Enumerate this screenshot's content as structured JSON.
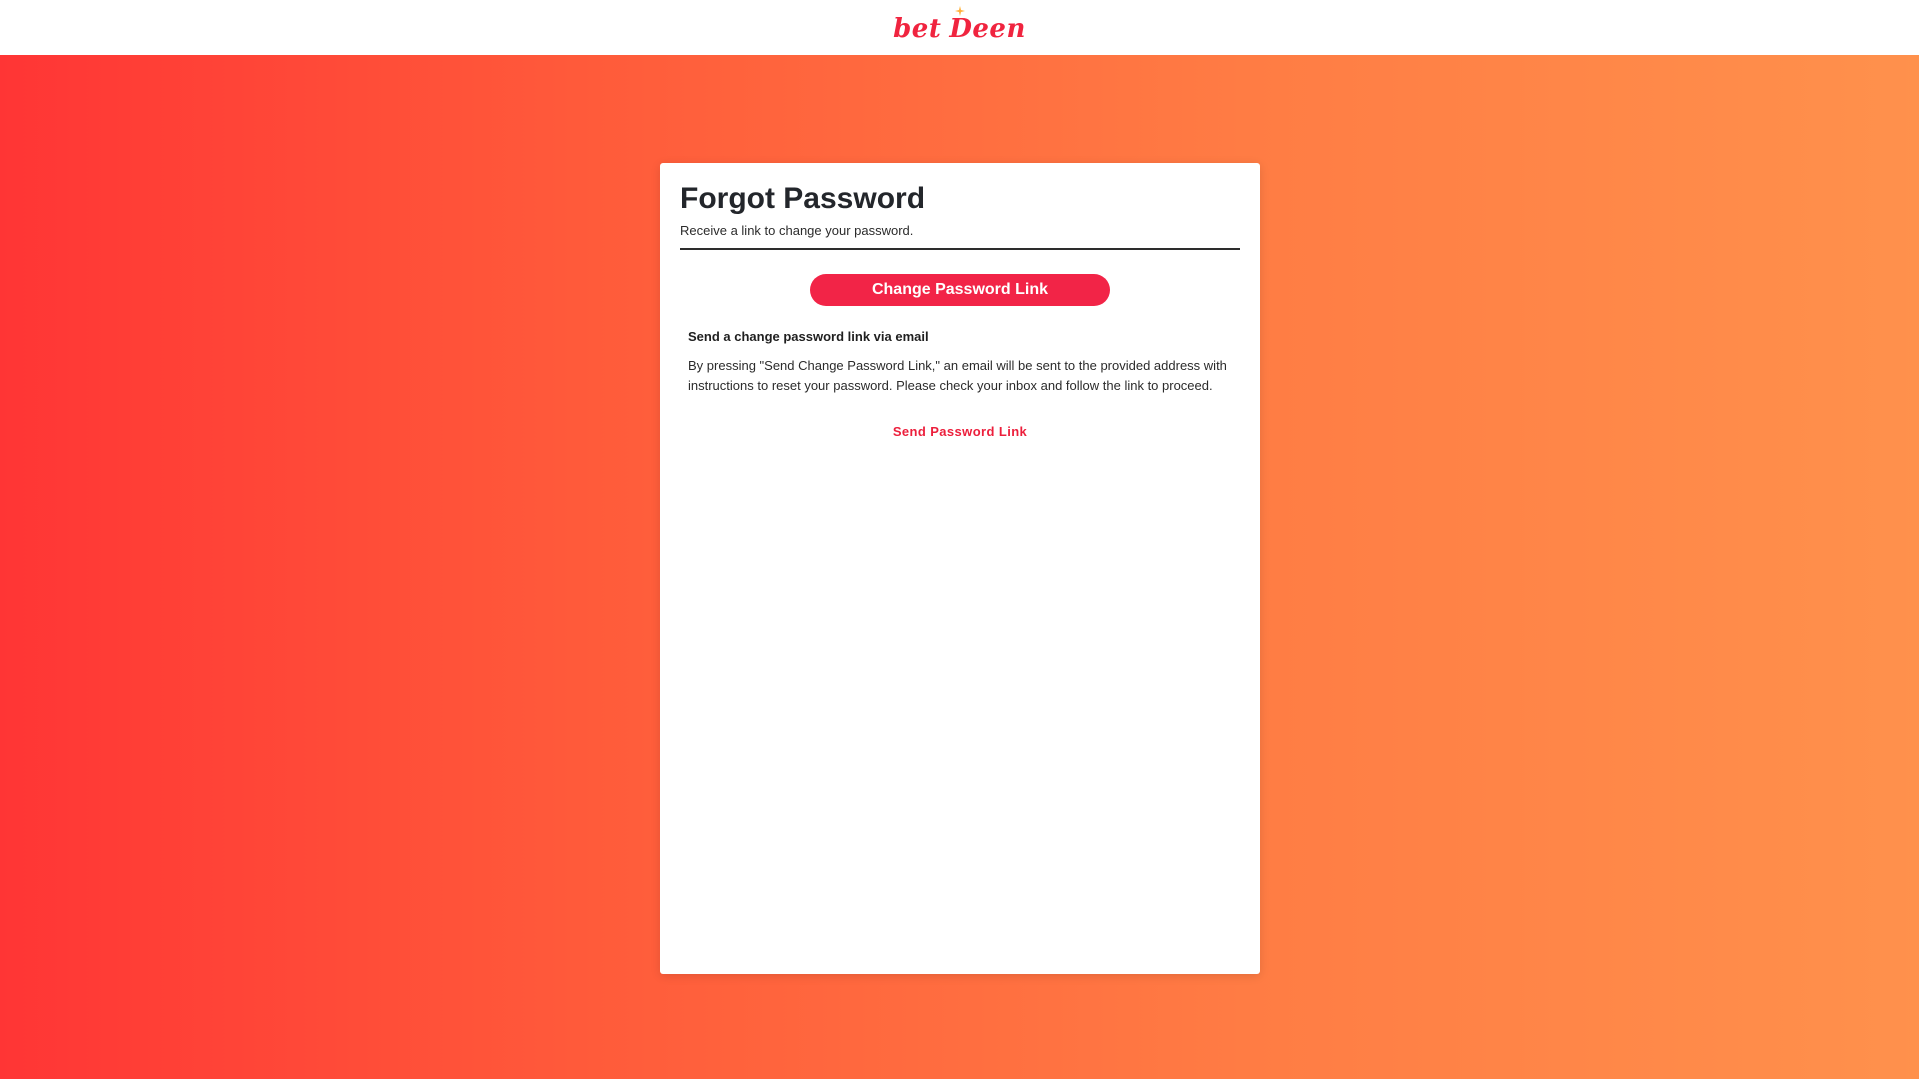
{
  "header": {
    "logo_part1": "bet",
    "logo_part2": "Deen"
  },
  "card": {
    "title": "Forgot Password",
    "subtitle": "Receive a link to change your password.",
    "primary_button_label": "Change Password Link",
    "section_title": "Send a change password link via email",
    "section_text": "By pressing \"Send Change Password Link,\" an email will be sent to the provided address with instructions to reset your password. Please check your inbox and follow the link to proceed.",
    "send_link_label": "Send Password Link"
  },
  "colors": {
    "brand": "#f22447",
    "gradient_start": "#ff3535",
    "gradient_end": "#ff914c"
  }
}
